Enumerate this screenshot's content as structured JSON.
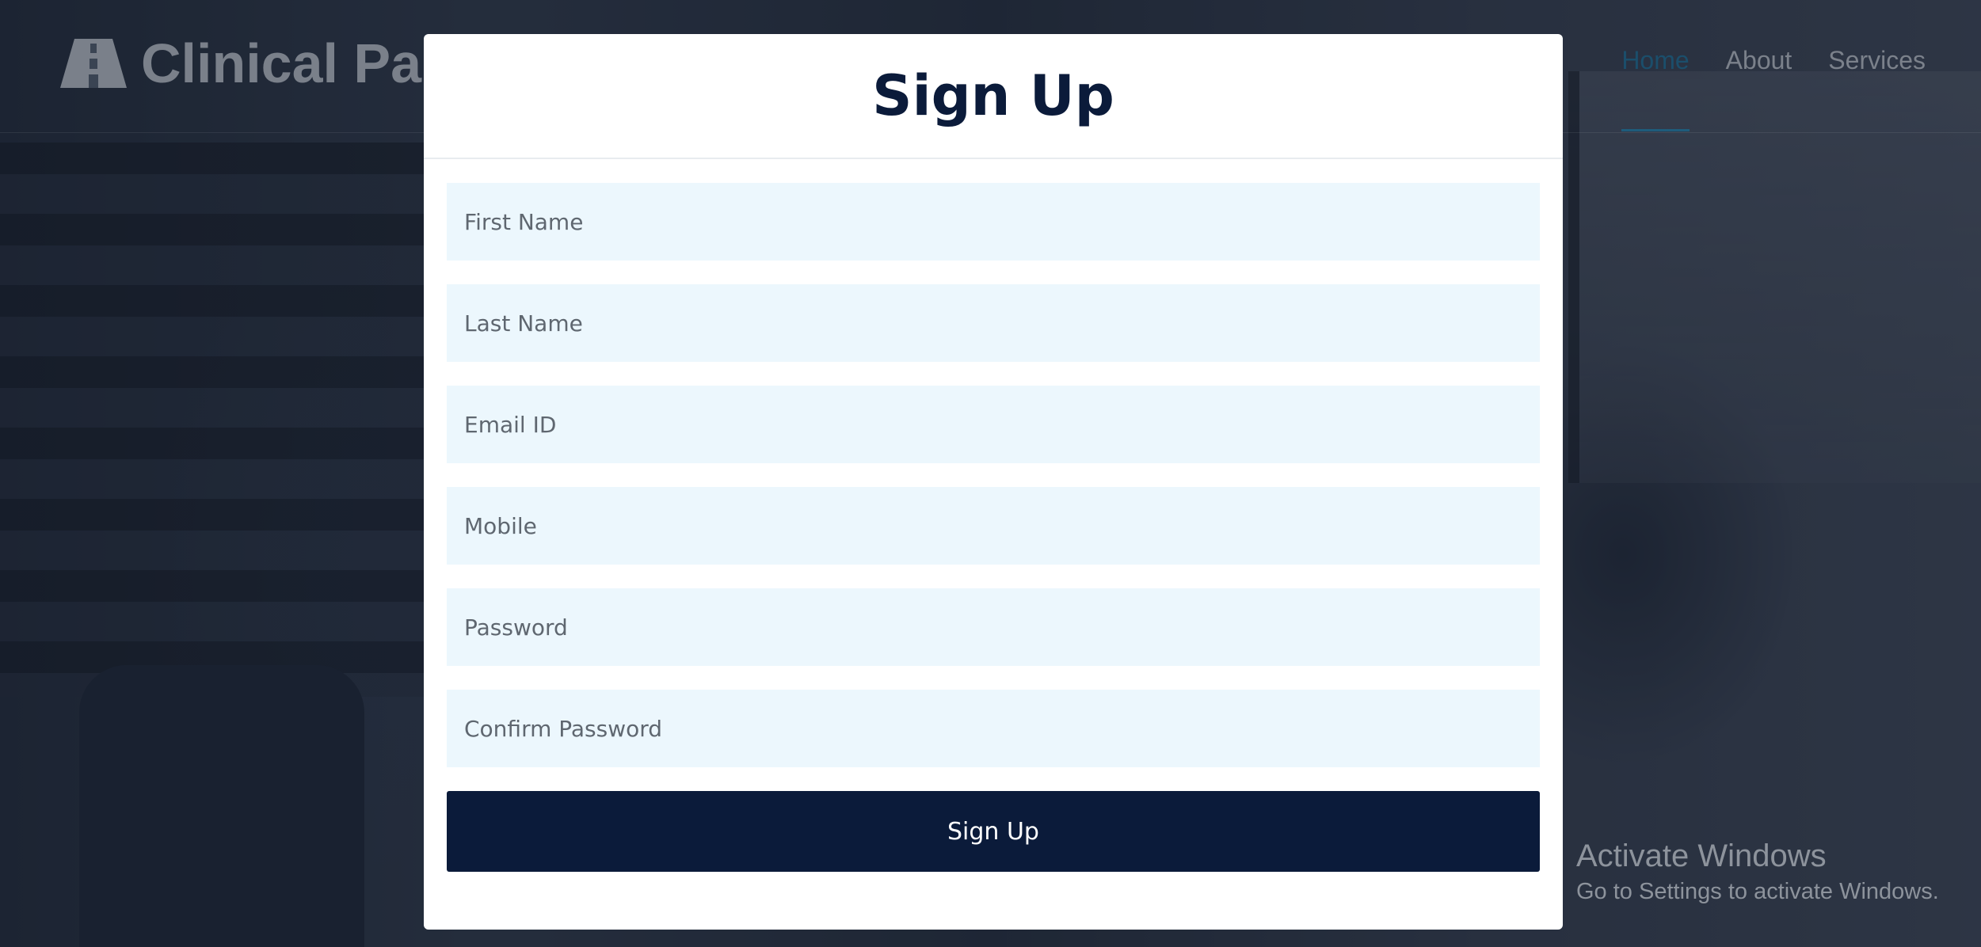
{
  "header": {
    "brand": "Clinical Pa",
    "brand_icon": "road-icon",
    "nav": [
      {
        "label": "Home",
        "active": true
      },
      {
        "label": "About",
        "active": false
      },
      {
        "label": "Services",
        "active": false
      }
    ]
  },
  "modal": {
    "title": "Sign Up",
    "fields": [
      {
        "placeholder": "First Name",
        "value": ""
      },
      {
        "placeholder": "Last Name",
        "value": ""
      },
      {
        "placeholder": "Email ID",
        "value": ""
      },
      {
        "placeholder": "Mobile",
        "value": ""
      },
      {
        "placeholder": "Password",
        "value": ""
      },
      {
        "placeholder": "Confirm Password",
        "value": ""
      }
    ],
    "submit_label": "Sign Up"
  },
  "watermark": {
    "title": "Activate Windows",
    "subtitle": "Go to Settings to activate Windows."
  },
  "colors": {
    "primary": "#0b1b3a",
    "field_bg": "#ecf7fd",
    "nav_active": "#1b4e6b"
  }
}
